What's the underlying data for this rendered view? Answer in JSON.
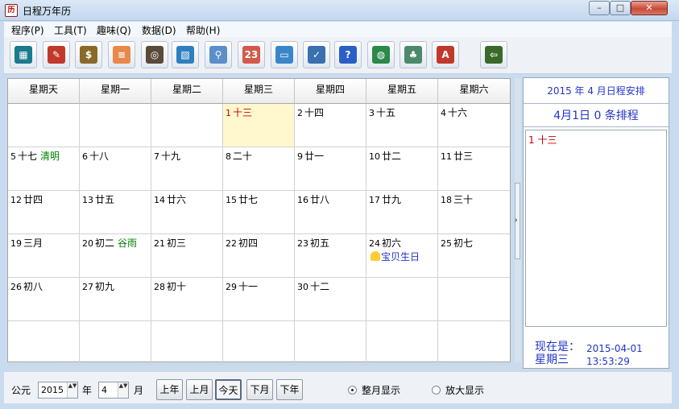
{
  "window": {
    "title": "日程万年历",
    "app_icon_glyph": "历",
    "minimize_glyph": "–",
    "maximize_glyph": "□",
    "close_glyph": "✕"
  },
  "menu": [
    {
      "label": "程序(P)"
    },
    {
      "label": "工具(T)"
    },
    {
      "label": "趣味(Q)"
    },
    {
      "label": "数据(D)"
    },
    {
      "label": "帮助(H)"
    }
  ],
  "toolbar": {
    "buttons": [
      {
        "icon": "calculator-icon",
        "glyph": "▦",
        "color": "#1b7a8c"
      },
      {
        "icon": "notebook-icon",
        "glyph": "✎",
        "color": "#c0392b"
      },
      {
        "icon": "money-bag-icon",
        "glyph": "$",
        "color": "#8a6a2a"
      },
      {
        "icon": "memo-icon",
        "glyph": "≡",
        "color": "#e8894a"
      },
      {
        "icon": "film-icon",
        "glyph": "◎",
        "color": "#5a4a3a"
      },
      {
        "icon": "picture-icon",
        "glyph": "▧",
        "color": "#2f7fbf"
      },
      {
        "icon": "magnifier-icon",
        "glyph": "⚲",
        "color": "#5a8fc8"
      },
      {
        "icon": "calendar-icon",
        "glyph": "23",
        "color": "#d35a4a"
      },
      {
        "icon": "monitor-icon",
        "glyph": "▭",
        "color": "#3a86c8"
      },
      {
        "icon": "checklist-icon",
        "glyph": "✓",
        "color": "#3a6fb0"
      },
      {
        "icon": "help-icon",
        "glyph": "?",
        "color": "#2a5fc8"
      },
      {
        "icon": "globe-icon",
        "glyph": "◍",
        "color": "#2a8a4a"
      },
      {
        "icon": "stamp-icon",
        "glyph": "♣",
        "color": "#4a8a6a"
      },
      {
        "icon": "font-icon",
        "glyph": "A",
        "color": "#c0392b"
      },
      {
        "icon": "exit-door-icon",
        "glyph": "⇦",
        "color": "#3a6a2a"
      }
    ]
  },
  "calendar": {
    "weekdays": [
      "星期天",
      "星期一",
      "星期二",
      "星期三",
      "星期四",
      "星期五",
      "星期六"
    ],
    "days": [
      {
        "day": "",
        "lunar": ""
      },
      {
        "day": "",
        "lunar": ""
      },
      {
        "day": "",
        "lunar": ""
      },
      {
        "day": "1",
        "lunar": "十三",
        "today": true
      },
      {
        "day": "2",
        "lunar": "十四"
      },
      {
        "day": "3",
        "lunar": "十五"
      },
      {
        "day": "4",
        "lunar": "十六"
      },
      {
        "day": "5",
        "lunar": "十七",
        "term": "清明"
      },
      {
        "day": "6",
        "lunar": "十八"
      },
      {
        "day": "7",
        "lunar": "十九"
      },
      {
        "day": "8",
        "lunar": "二十"
      },
      {
        "day": "9",
        "lunar": "廿一"
      },
      {
        "day": "10",
        "lunar": "廿二"
      },
      {
        "day": "11",
        "lunar": "廿三"
      },
      {
        "day": "12",
        "lunar": "廿四"
      },
      {
        "day": "13",
        "lunar": "廿五"
      },
      {
        "day": "14",
        "lunar": "廿六"
      },
      {
        "day": "15",
        "lunar": "廿七"
      },
      {
        "day": "16",
        "lunar": "廿八"
      },
      {
        "day": "17",
        "lunar": "廿九"
      },
      {
        "day": "18",
        "lunar": "三十"
      },
      {
        "day": "19",
        "lunar": "三月"
      },
      {
        "day": "20",
        "lunar": "初二",
        "term": "谷雨"
      },
      {
        "day": "21",
        "lunar": "初三"
      },
      {
        "day": "22",
        "lunar": "初四"
      },
      {
        "day": "23",
        "lunar": "初五"
      },
      {
        "day": "24",
        "lunar": "初六",
        "note": "宝贝生日"
      },
      {
        "day": "25",
        "lunar": "初七"
      },
      {
        "day": "26",
        "lunar": "初八"
      },
      {
        "day": "27",
        "lunar": "初九"
      },
      {
        "day": "28",
        "lunar": "初十"
      },
      {
        "day": "29",
        "lunar": "十一"
      },
      {
        "day": "30",
        "lunar": "十二"
      },
      {
        "day": "",
        "lunar": ""
      },
      {
        "day": "",
        "lunar": ""
      },
      {
        "day": "",
        "lunar": ""
      },
      {
        "day": "",
        "lunar": ""
      },
      {
        "day": "",
        "lunar": ""
      },
      {
        "day": "",
        "lunar": ""
      },
      {
        "day": "",
        "lunar": ""
      },
      {
        "day": "",
        "lunar": ""
      },
      {
        "day": "",
        "lunar": ""
      }
    ]
  },
  "splitter": {
    "arrow": "›"
  },
  "schedule": {
    "title": "2015 年 4 月日程安排",
    "count_text": "4月1日 0 条排程",
    "entry": "1 十三",
    "now_label": "现在是：",
    "now_weekday": "星期三",
    "now_date": "2015-04-01",
    "now_time": "13:53:29"
  },
  "bottom": {
    "era_label": "公元",
    "year_value": "2015",
    "year_label": "年",
    "month_value": "4",
    "month_label": "月",
    "spin_arrows": "▲▼",
    "nav_buttons": [
      "上年",
      "上月",
      "今天",
      "下月",
      "下年"
    ],
    "view_full": "整月显示",
    "view_zoom": "放大显示",
    "selected_view": "full"
  }
}
